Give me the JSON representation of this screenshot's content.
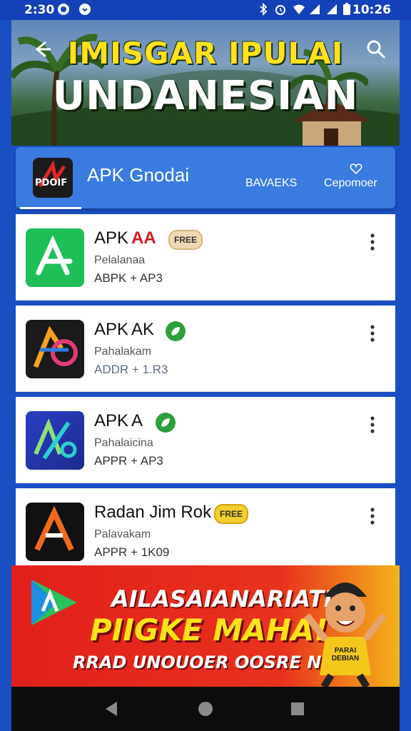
{
  "status_bar": {
    "time": "2:30",
    "clock": "10:26",
    "icons": [
      "media-icon",
      "notification-icon",
      "bluetooth-icon",
      "alarm-icon",
      "wifi-icon",
      "signal-icon",
      "battery-icon"
    ]
  },
  "hero": {
    "title_line1": "IMISGAR IPULAI",
    "title_line2": "UNDANESIAN"
  },
  "tabbar": {
    "logo_text": "PDOIF",
    "title": "APK Gnodai",
    "tabs": [
      {
        "label": "BAVAEKS"
      },
      {
        "label": "Cepomoer"
      }
    ]
  },
  "apps": [
    {
      "name": "APK",
      "name_extra": "AA",
      "badge": "FREE",
      "badge_style": "pale",
      "developer": "Pelalanaa",
      "meta": "ABPK + AP3",
      "icon": "green-tile-icon"
    },
    {
      "name": "APK",
      "name_extra": "AK",
      "badge": "",
      "badge_style": "green",
      "developer": "Pahalakam",
      "meta": "ADDR + 1.R3",
      "icon": "colorful-fa-icon"
    },
    {
      "name": "APK",
      "name_extra": "A",
      "badge": "",
      "badge_style": "green",
      "developer": "Pahalaicina",
      "meta": "APPR + AP3",
      "icon": "blue-percent-icon"
    },
    {
      "name": "Radan Jim Rok",
      "name_extra": "",
      "badge": "FREE",
      "badge_style": "gold",
      "developer": "Palavakam",
      "meta": "APPR + 1K09",
      "icon": "orange-a-icon"
    }
  ],
  "banner": {
    "line1": "AILASAIANARIATI",
    "line2": "PIIGKE MAHA!",
    "line3": "RRAD UNOUOER OOSRE NONY",
    "mascot_shirt": "PARAI DEBIAN"
  },
  "colors": {
    "frame": "#1a4fc4",
    "tabbar": "#3a7be0",
    "banner_red": "#e21f1b",
    "banner_yellow": "#ffe21a"
  }
}
